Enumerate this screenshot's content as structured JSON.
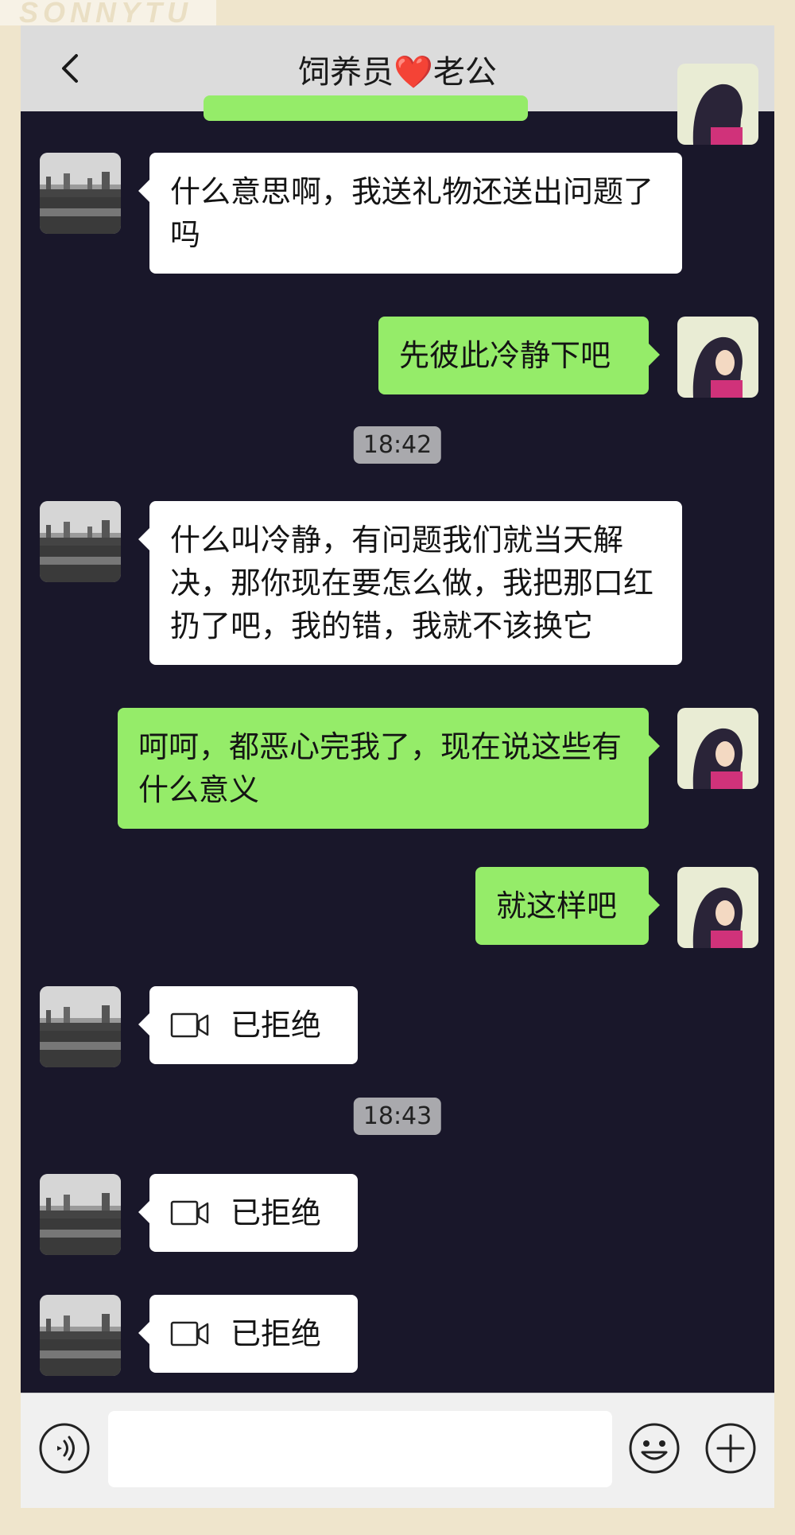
{
  "watermark": "SONNYTU",
  "header": {
    "title_left": "饲养员",
    "title_heart": "❤️",
    "title_right": "老公"
  },
  "messages": [
    {
      "side": "left",
      "type": "text",
      "text": "什么意思啊，我送礼物还送出问题了吗"
    },
    {
      "side": "right",
      "type": "text",
      "text": "先彼此冷静下吧"
    },
    {
      "type": "time",
      "text": "18:42"
    },
    {
      "side": "left",
      "type": "text",
      "text": "什么叫冷静，有问题我们就当天解决，那你现在要怎么做，我把那口红扔了吧，我的错，我就不该换它"
    },
    {
      "side": "right",
      "type": "text",
      "text": "呵呵，都恶心完我了，现在说这些有什么意义"
    },
    {
      "side": "right",
      "type": "text",
      "text": "就这样吧"
    },
    {
      "side": "left",
      "type": "video_call",
      "text": "已拒绝"
    },
    {
      "type": "time",
      "text": "18:43"
    },
    {
      "side": "left",
      "type": "video_call",
      "text": "已拒绝"
    },
    {
      "side": "left",
      "type": "video_call",
      "text": "已拒绝"
    }
  ],
  "icons": {
    "back": "chevron-left-icon",
    "more": "more-icon",
    "voice": "voice-icon",
    "emoji": "emoji-icon",
    "plus": "plus-icon",
    "video": "video-camera-icon"
  },
  "colors": {
    "chat_bg": "#19172a",
    "bubble_sent": "#95ec69",
    "bubble_received": "#ffffff",
    "header_bg": "#dcdcdc",
    "page_bg": "#efe5cc"
  }
}
